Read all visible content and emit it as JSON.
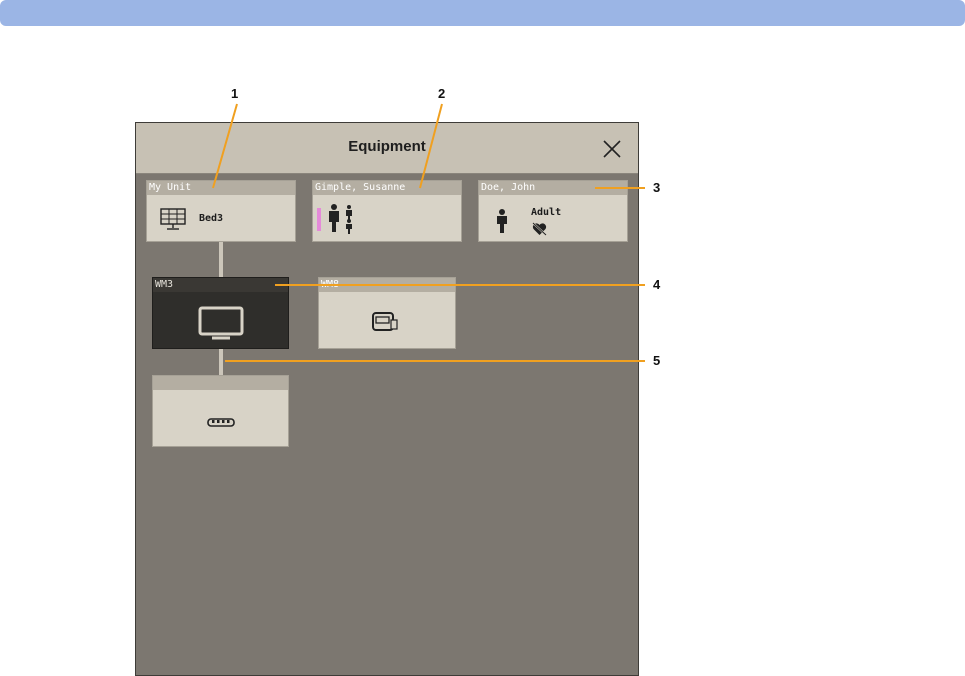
{
  "window": {
    "title": "Equipment"
  },
  "tiles": {
    "unit": {
      "header": "My Unit",
      "label": "Bed3",
      "icon": "bed-monitor-icon"
    },
    "patient1": {
      "header": "Gimple, Susanne",
      "icon": "mother-baby-icon"
    },
    "patient2": {
      "header": "Doe, John",
      "category": "Adult",
      "icon": "adult-icon"
    },
    "device1": {
      "header": "WM3",
      "icon": "monitor-icon"
    },
    "device2": {
      "header": "WM8",
      "icon": "telemetry-device-icon"
    },
    "device3": {
      "header": "",
      "icon": "network-hub-icon"
    }
  },
  "callouts": [
    "1",
    "2",
    "3",
    "4",
    "5"
  ],
  "colors": {
    "accent_bar": "#9bb5e5",
    "callout_line": "#f0a020",
    "window_bg": "#7c7770",
    "tile_bg": "#d8d3c7",
    "selected_tile_bg": "#2f2e2b",
    "pink_indicator": "#e58ad9"
  }
}
